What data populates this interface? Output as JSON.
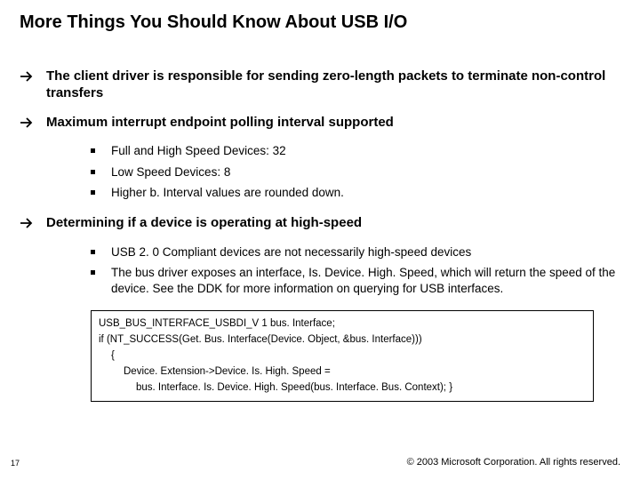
{
  "title": "More Things You Should Know About USB I/O",
  "bullets": [
    {
      "text": "The client driver is responsible for sending zero-length packets to terminate non-control transfers",
      "sub": []
    },
    {
      "text": "Maximum interrupt endpoint polling interval supported",
      "sub": [
        "Full and High Speed Devices: 32",
        "Low Speed Devices: 8",
        "Higher b. Interval values are rounded down."
      ]
    },
    {
      "text": "Determining if a device is operating at high-speed",
      "sub": [
        "USB 2. 0 Compliant devices are not necessarily high-speed devices",
        "The bus driver exposes an interface, Is. Device. High. Speed, which will return the speed of the device.  See the DDK for more information on querying for USB interfaces."
      ]
    }
  ],
  "code": {
    "l0": "USB_BUS_INTERFACE_USBDI_V 1  bus. Interface;",
    "l1": "if (NT_SUCCESS(Get. Bus. Interface(Device. Object, &bus. Interface)))",
    "l2": "{",
    "l3": "Device. Extension->Device. Is. High. Speed =",
    "l4": "bus. Interface. Is. Device. High. Speed(bus. Interface. Bus. Context); }"
  },
  "page_number": "17",
  "copyright": "© 2003 Microsoft Corporation. All rights reserved."
}
